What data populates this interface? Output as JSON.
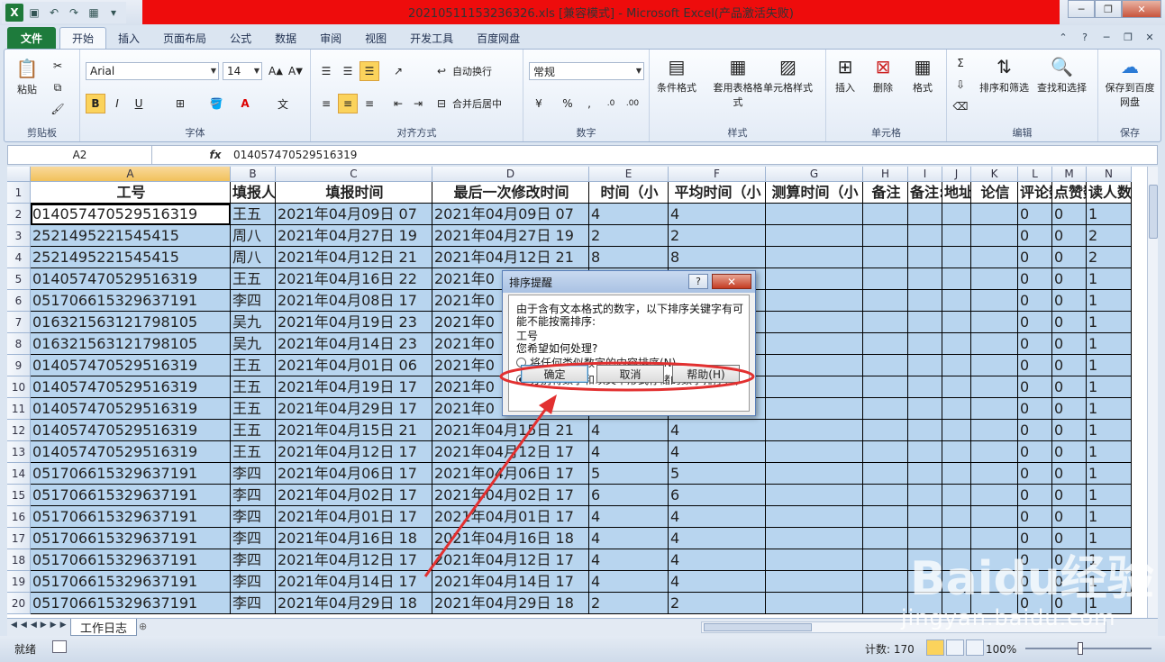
{
  "window": {
    "title": "20210511153236326.xls  [兼容模式]  -  Microsoft Excel(产品激活失败)",
    "controls": {
      "minimize": "─",
      "restore": "❐",
      "close": "✕"
    }
  },
  "tabs": [
    "文件",
    "开始",
    "插入",
    "页面布局",
    "公式",
    "数据",
    "审阅",
    "视图",
    "开发工具",
    "百度网盘"
  ],
  "ribbon": {
    "clipboard": {
      "paste": "粘贴",
      "title": "剪贴板"
    },
    "font": {
      "name": "Arial",
      "size": "14",
      "bold": "B",
      "italic": "I",
      "underline": "U",
      "title": "字体"
    },
    "alignment": {
      "wrap": "自动换行",
      "merge": "合并后居中",
      "title": "对齐方式"
    },
    "number": {
      "format": "常规",
      "title": "数字"
    },
    "styles": {
      "cond": "条件格式",
      "table": "套用表格格式",
      "cell": "单元格样式",
      "title": "样式"
    },
    "cells": {
      "insert": "插入",
      "delete": "删除",
      "format": "格式",
      "title": "单元格"
    },
    "editing": {
      "sort": "排序和筛选",
      "find": "查找和选择",
      "title": "编辑"
    },
    "save": {
      "label": "保存到百度网盘",
      "title": "保存"
    }
  },
  "formula_bar": {
    "name_box": "A2",
    "fx": "fx",
    "value": "014057470529516319"
  },
  "columns": [
    "A",
    "B",
    "C",
    "D",
    "E",
    "F",
    "G",
    "H",
    "I",
    "J",
    "K",
    "L",
    "M",
    "N"
  ],
  "header_row": [
    "工号",
    "填报人",
    "填报时间",
    "最后一次修改时间",
    "时间（小",
    "平均时间（小",
    "测算时间（小",
    "备注",
    "备注:",
    "地址",
    "论信",
    "评论数",
    "点赞数",
    "读人数"
  ],
  "rows": [
    [
      "014057470529516319",
      "王五",
      "2021年04月09日 07",
      "2021年04月09日 07",
      "4",
      "4",
      "",
      "",
      "",
      "",
      "",
      "0",
      "0",
      "1"
    ],
    [
      "2521495221545415",
      "周八",
      "2021年04月27日 19",
      "2021年04月27日 19",
      "2",
      "2",
      "",
      "",
      "",
      "",
      "",
      "0",
      "0",
      "2"
    ],
    [
      "2521495221545415",
      "周八",
      "2021年04月12日 21",
      "2021年04月12日 21",
      "8",
      "8",
      "",
      "",
      "",
      "",
      "",
      "0",
      "0",
      "2"
    ],
    [
      "014057470529516319",
      "王五",
      "2021年04月16日 22",
      "2021年0",
      "",
      "",
      "",
      "",
      "",
      "",
      "",
      "0",
      "0",
      "1"
    ],
    [
      "051706615329637191",
      "李四",
      "2021年04月08日 17",
      "2021年0",
      "",
      "",
      "",
      "",
      "",
      "",
      "",
      "0",
      "0",
      "1"
    ],
    [
      "016321563121798105",
      "吴九",
      "2021年04月19日 23",
      "2021年0",
      "",
      "",
      "",
      "",
      "",
      "",
      "",
      "0",
      "0",
      "1"
    ],
    [
      "016321563121798105",
      "吴九",
      "2021年04月14日 23",
      "2021年0",
      "",
      "",
      "",
      "",
      "",
      "",
      "",
      "0",
      "0",
      "1"
    ],
    [
      "014057470529516319",
      "王五",
      "2021年04月01日 06",
      "2021年0",
      "",
      "",
      "",
      "",
      "",
      "",
      "",
      "0",
      "0",
      "1"
    ],
    [
      "014057470529516319",
      "王五",
      "2021年04月19日 17",
      "2021年0",
      "",
      "",
      "",
      "",
      "",
      "",
      "",
      "0",
      "0",
      "1"
    ],
    [
      "014057470529516319",
      "王五",
      "2021年04月29日 17",
      "2021年0",
      "",
      "",
      "",
      "",
      "",
      "",
      "",
      "0",
      "0",
      "1"
    ],
    [
      "014057470529516319",
      "王五",
      "2021年04月15日 21",
      "2021年04月15日 21",
      "4",
      "4",
      "",
      "",
      "",
      "",
      "",
      "0",
      "0",
      "1"
    ],
    [
      "014057470529516319",
      "王五",
      "2021年04月12日 17",
      "2021年04月12日 17",
      "4",
      "4",
      "",
      "",
      "",
      "",
      "",
      "0",
      "0",
      "1"
    ],
    [
      "051706615329637191",
      "李四",
      "2021年04月06日 17",
      "2021年04月06日 17",
      "5",
      "5",
      "",
      "",
      "",
      "",
      "",
      "0",
      "0",
      "1"
    ],
    [
      "051706615329637191",
      "李四",
      "2021年04月02日 17",
      "2021年04月02日 17",
      "6",
      "6",
      "",
      "",
      "",
      "",
      "",
      "0",
      "0",
      "1"
    ],
    [
      "051706615329637191",
      "李四",
      "2021年04月01日 17",
      "2021年04月01日 17",
      "4",
      "4",
      "",
      "",
      "",
      "",
      "",
      "0",
      "0",
      "1"
    ],
    [
      "051706615329637191",
      "李四",
      "2021年04月16日 18",
      "2021年04月16日 18",
      "4",
      "4",
      "",
      "",
      "",
      "",
      "",
      "0",
      "0",
      "1"
    ],
    [
      "051706615329637191",
      "李四",
      "2021年04月12日 17",
      "2021年04月12日 17",
      "4",
      "4",
      "",
      "",
      "",
      "",
      "",
      "0",
      "0",
      "1"
    ],
    [
      "051706615329637191",
      "李四",
      "2021年04月14日 17",
      "2021年04月14日 17",
      "4",
      "4",
      "",
      "",
      "",
      "",
      "",
      "0",
      "0",
      "1"
    ],
    [
      "051706615329637191",
      "李四",
      "2021年04月29日 18",
      "2021年04月29日 18",
      "2",
      "2",
      "",
      "",
      "",
      "",
      "",
      "0",
      "0",
      "1"
    ]
  ],
  "sheet_tab": "工作日志",
  "status": {
    "ready": "就绪",
    "count": "计数: 170",
    "zoom": "100%"
  },
  "dialog": {
    "title": "排序提醒",
    "help": "?",
    "close": "✕",
    "line1": "由于含有文本格式的数字，以下排序关键字有可",
    "line2": "能不能按需排序:",
    "key": "工号",
    "question": "您希望如何处理?",
    "option1": "将任何类似数字的内容排序(N)",
    "option2": "分别将数字和以文本形式存储的数字排序(T)",
    "ok": "确定",
    "cancel": "取消",
    "helpbtn": "帮助(H)"
  },
  "watermark": {
    "brand": "Baidu经验",
    "url": "jingyan.baidu.com"
  },
  "colors": {
    "excel_green": "#1e7b3c",
    "title_red": "#ee0c0c",
    "selection_blue": "#b8d5ef",
    "annotation_red": "#e23030"
  }
}
